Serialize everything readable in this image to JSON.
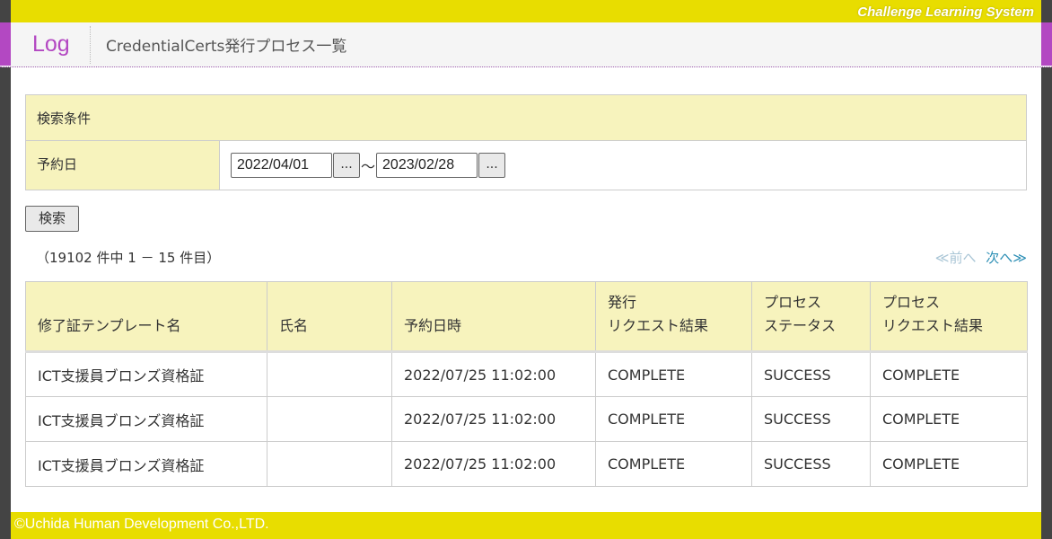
{
  "brand": "Challenge Learning System",
  "header": {
    "log_label": "Log",
    "page_title": "CredentialCerts発行プロセス一覧"
  },
  "search": {
    "heading": "検索条件",
    "date_label": "予約日",
    "date_from": "2022/04/01",
    "date_to": "2023/02/28",
    "cal_button": "...",
    "range_separator": "～",
    "search_button": "検索"
  },
  "results": {
    "count_text": "（19102 件中 1 － 15 件目）",
    "prev_label": "≪前へ",
    "next_label": "次へ≫",
    "columns": [
      {
        "line1": "修了証テンプレート名",
        "line2": ""
      },
      {
        "line1": "氏名",
        "line2": ""
      },
      {
        "line1": "予約日時",
        "line2": ""
      },
      {
        "line1": "発行",
        "line2": "リクエスト結果"
      },
      {
        "line1": "プロセス",
        "line2": "ステータス"
      },
      {
        "line1": "プロセス",
        "line2": "リクエスト結果"
      }
    ],
    "rows": [
      {
        "template": "ICT支援員ブロンズ資格証",
        "name": "",
        "scheduled": "2022/07/25 11:02:00",
        "issue_result": "COMPLETE",
        "process_status": "SUCCESS",
        "process_result": "COMPLETE"
      },
      {
        "template": "ICT支援員ブロンズ資格証",
        "name": "",
        "scheduled": "2022/07/25 11:02:00",
        "issue_result": "COMPLETE",
        "process_status": "SUCCESS",
        "process_result": "COMPLETE"
      },
      {
        "template": "ICT支援員ブロンズ資格証",
        "name": "",
        "scheduled": "2022/07/25 11:02:00",
        "issue_result": "COMPLETE",
        "process_status": "SUCCESS",
        "process_result": "COMPLETE"
      }
    ]
  },
  "footer": {
    "copyright": "©Uchida Human Development Co.,LTD."
  },
  "colors": {
    "brand_yellow": "#e8dd00",
    "accent_purple": "#b348c2",
    "header_cell_bg": "#f7f3bd",
    "link_blue": "#2d8fb5"
  }
}
